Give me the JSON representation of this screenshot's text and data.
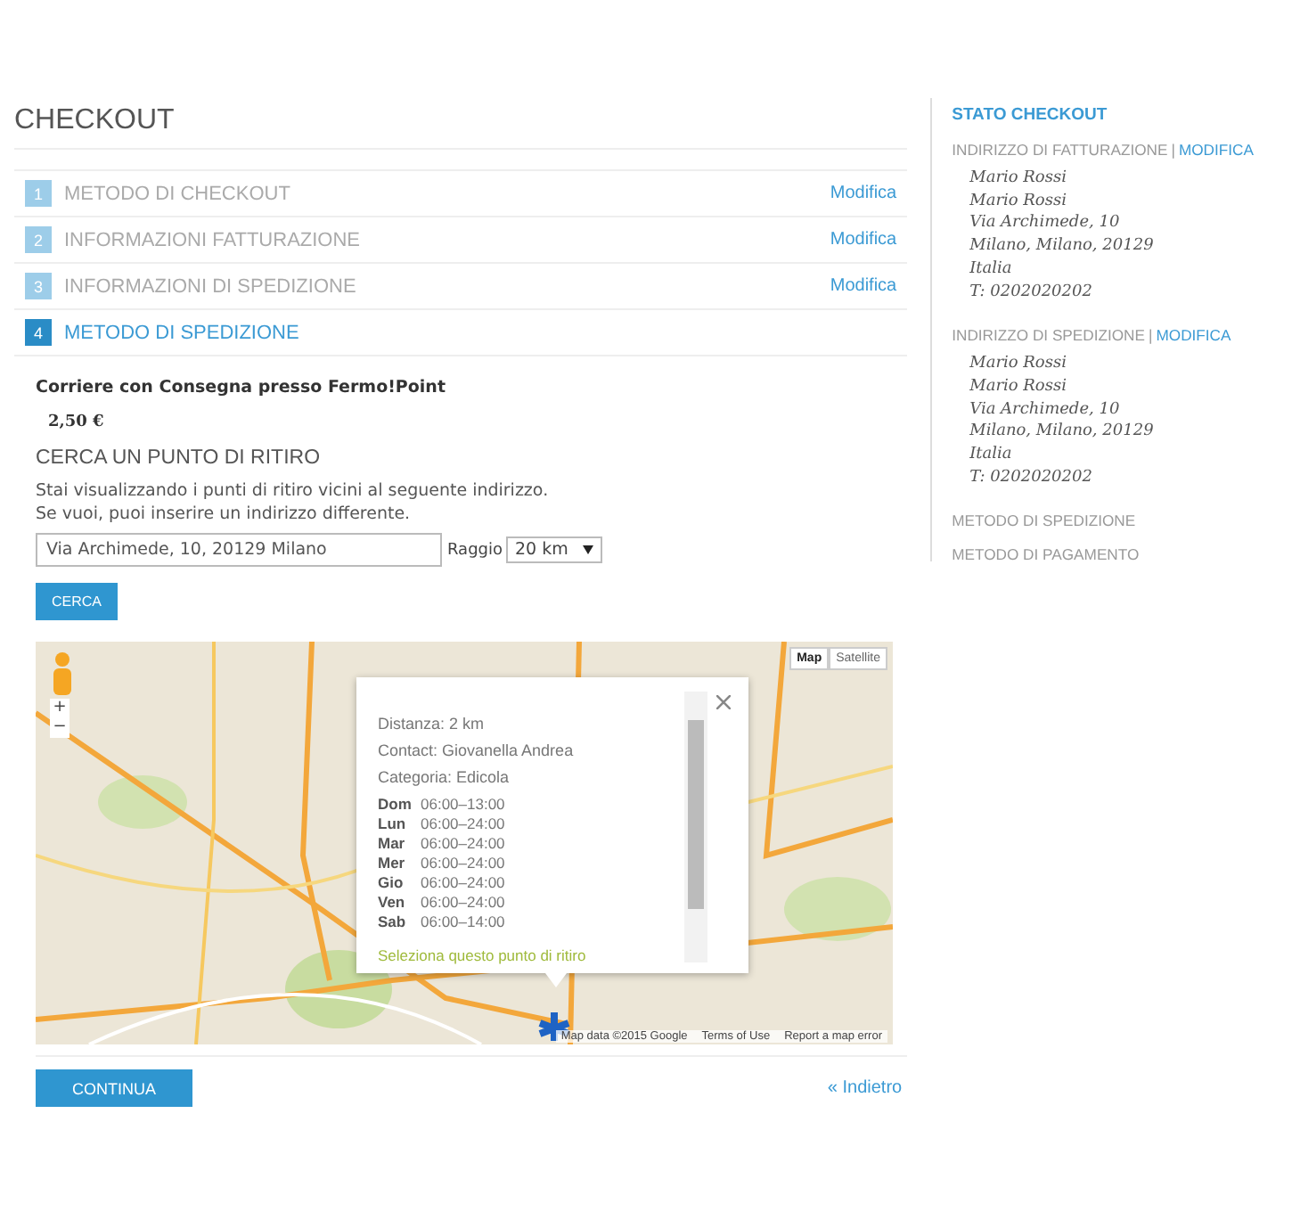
{
  "title": "CHECKOUT",
  "steps": [
    {
      "number": "1",
      "label": "METODO DI CHECKOUT",
      "edit_link": "Modifica",
      "selected": false
    },
    {
      "number": "2",
      "label": "INFORMAZIONI FATTURAZIONE",
      "edit_link": "Modifica",
      "selected": false
    },
    {
      "number": "3",
      "label": "INFORMAZIONI DI SPEDIZIONE",
      "edit_link": "Modifica",
      "selected": false
    },
    {
      "number": "4",
      "label": "METODO DI SPEDIZIONE",
      "selected": true
    }
  ],
  "shipping": {
    "carrier": "Corriere con Consegna presso Fermo!Point",
    "price": "2,50 €",
    "heading": "CERCA UN PUNTO DI RITIRO",
    "intro": [
      "Stai visualizzando i punti di ritiro vicini al seguente indirizzo.",
      "Se vuoi, puoi inserire un indirizzo differente."
    ],
    "address": "Via Archimede, 10, 20129 Milano",
    "radius_label": "Raggio",
    "radius": "20 km",
    "search_button": "CERCA"
  },
  "map": {
    "type_buttons": [
      {
        "label": "Map",
        "selected": true
      },
      {
        "label": "Satellite",
        "selected": false
      }
    ],
    "zoom_in": "+",
    "zoom_out": "−",
    "info": {
      "lines": [
        {
          "label": "Distanza:",
          "value": "2 km"
        },
        {
          "label": "Contact:",
          "value": "Giovanella Andrea"
        },
        {
          "label": "Categoria:",
          "value": "Edicola"
        }
      ],
      "hours": [
        {
          "day": "Dom",
          "time": "06:00–13:00"
        },
        {
          "day": "Lun",
          "time": "06:00–24:00"
        },
        {
          "day": "Mar",
          "time": "06:00–24:00"
        },
        {
          "day": "Mer",
          "time": "06:00–24:00"
        },
        {
          "day": "Gio",
          "time": "06:00–24:00"
        },
        {
          "day": "Ven",
          "time": "06:00–24:00"
        },
        {
          "day": "Sab",
          "time": "06:00–14:00"
        }
      ],
      "select_link": "Seleziona questo punto di ritiro"
    },
    "attribution": "Map data ©2015 Google",
    "terms": "Terms of Use",
    "report": "Report a map error"
  },
  "continue_button": "CONTINUA",
  "back_link": "« Indietro",
  "sidebar": {
    "title": "STATO CHECKOUT",
    "sections": [
      {
        "heading": "INDIRIZZO DI FATTURAZIONE",
        "separator": "|",
        "edit_link": "MODIFICA",
        "lines": [
          "Mario Rossi",
          "Mario Rossi",
          "Via Archimede, 10",
          "Milano, Milano, 20129",
          "Italia",
          "T: 0202020202"
        ]
      },
      {
        "heading": "INDIRIZZO DI SPEDIZIONE",
        "separator": "|",
        "edit_link": "MODIFICA",
        "lines": [
          "Mario Rossi",
          "Mario Rossi",
          "Via Archimede, 10",
          "Milano, Milano, 20129",
          "Italia",
          "T: 0202020202"
        ]
      },
      {
        "heading": "METODO DI SPEDIZIONE"
      },
      {
        "heading": "METODO DI PAGAMENTO"
      }
    ]
  }
}
